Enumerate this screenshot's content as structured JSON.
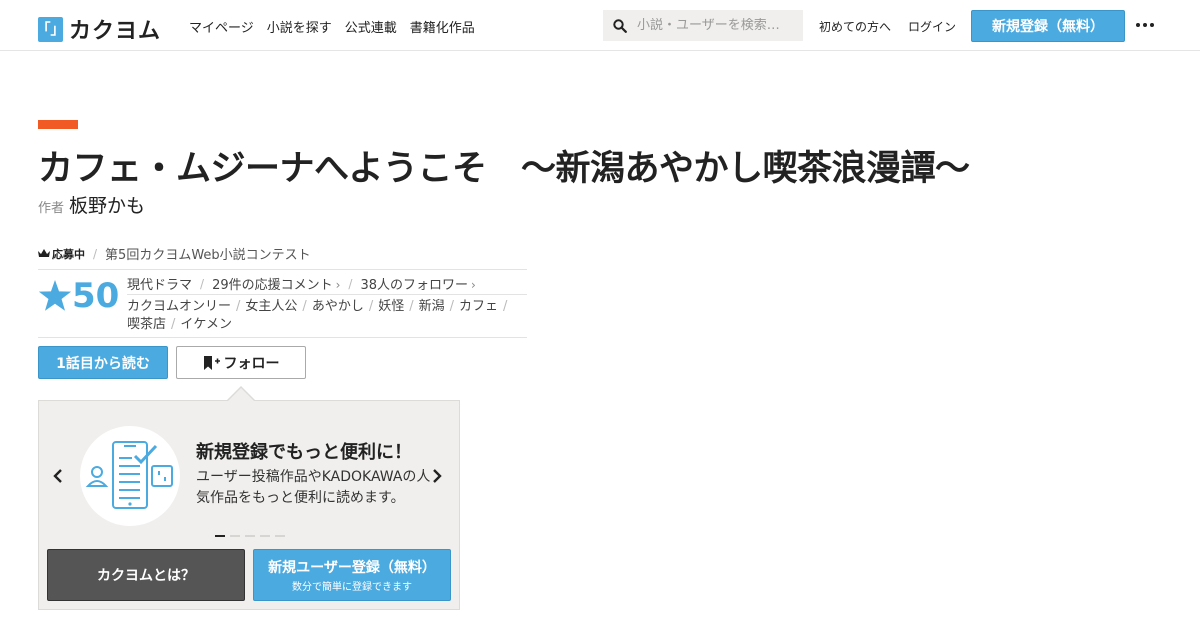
{
  "header": {
    "logo_mark": "「」",
    "logo_text": "カクヨム",
    "nav": [
      "マイページ",
      "小説を探す",
      "公式連載",
      "書籍化作品"
    ],
    "search_placeholder": "小説・ユーザーを検索…",
    "first_time": "初めての方へ",
    "login": "ログイン",
    "signup": "新規登録（無料）"
  },
  "work": {
    "title": "カフェ・ムジーナへようこそ　～新潟あやかし喫茶浪漫譚～",
    "author_label": "作者",
    "author_name": "板野かも",
    "contest_badge": "応募中",
    "contest_name": "第5回カクヨムWeb小説コンテスト",
    "stars": "50",
    "genre": "現代ドラマ",
    "comments": "29件の応援コメント",
    "followers": "38人のフォロワー",
    "tags": [
      "カクヨムオンリー",
      "女主人公",
      "あやかし",
      "妖怪",
      "新潟",
      "カフェ",
      "喫茶店",
      "イケメン"
    ],
    "read_button": "1話目から読む",
    "follow_button": "フォロー"
  },
  "promo": {
    "heading": "新規登録でもっと便利に！",
    "body": "ユーザー投稿作品やKADOKAWAの人気作品をもっと便利に読めます。",
    "about_button": "カクヨムとは？",
    "register_button": "新規ユーザー登録（無料）",
    "register_sub": "数分で簡単に登録できます"
  },
  "colors": {
    "accent": "#4BAAE0",
    "title_bar": "#f15a24"
  }
}
